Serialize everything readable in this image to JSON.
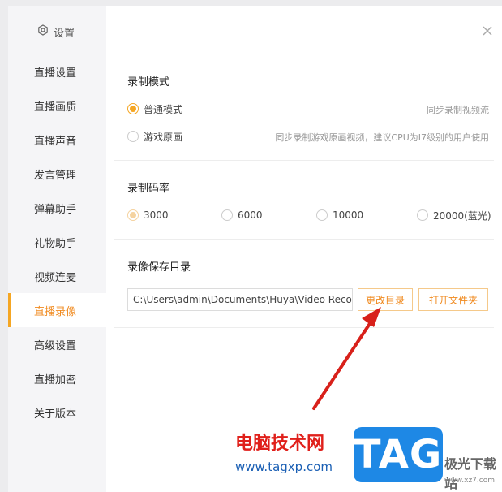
{
  "sidebar": {
    "title": "设置",
    "items": [
      {
        "label": "直播设置"
      },
      {
        "label": "直播画质"
      },
      {
        "label": "直播声音"
      },
      {
        "label": "发言管理"
      },
      {
        "label": "弹幕助手"
      },
      {
        "label": "礼物助手"
      },
      {
        "label": "视频连麦"
      },
      {
        "label": "直播录像",
        "active": true
      },
      {
        "label": "高级设置"
      },
      {
        "label": "直播加密"
      },
      {
        "label": "关于版本"
      }
    ]
  },
  "record_mode": {
    "title": "录制模式",
    "options": [
      {
        "label": "普通模式",
        "hint": "同步录制视频流",
        "checked": true
      },
      {
        "label": "游戏原画",
        "hint": "同步录制游戏原画视频，建议CPU为I7级别的用户使用",
        "checked": false
      }
    ]
  },
  "bitrate": {
    "title": "录制码率",
    "options": [
      {
        "label": "3000",
        "checked": true
      },
      {
        "label": "6000",
        "checked": false
      },
      {
        "label": "10000",
        "checked": false
      },
      {
        "label": "20000(蓝光)",
        "checked": false
      }
    ]
  },
  "save_dir": {
    "title": "录像保存目录",
    "path": "C:\\Users\\admin\\Documents\\Huya\\Video Recor",
    "change_button": "更改目录",
    "open_button": "打开文件夹"
  },
  "watermark": {
    "text1": "电脑技术网",
    "text2": "www.tagxp.com",
    "logo": "TAG",
    "site": "极光下载站",
    "site_url": "www.xz7.com"
  },
  "colors": {
    "accent": "#f5a623",
    "active_text": "#f08a1f"
  }
}
